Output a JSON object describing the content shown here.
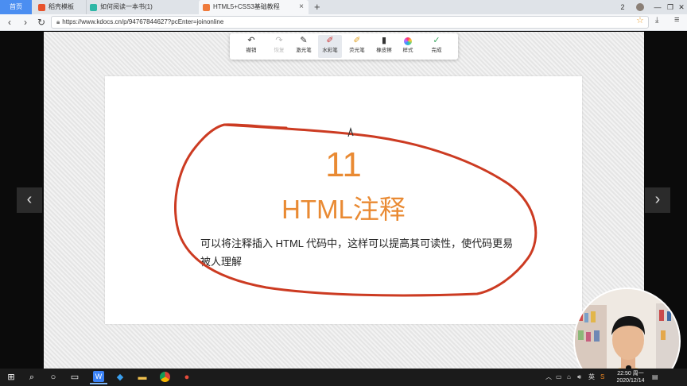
{
  "browser": {
    "tabs": [
      {
        "label": "首页"
      },
      {
        "label": "稻壳模板"
      },
      {
        "label": "如何阅读一本书(1)"
      },
      {
        "label": "HTML5+CSS3基础教程"
      }
    ],
    "new_tab_label": "+",
    "url": "https://www.kdocs.cn/p/94767844627?pcEnter=joinonline",
    "window_controls": [
      "2",
      "—",
      "❐",
      "✕"
    ]
  },
  "toolbar": {
    "tools": [
      {
        "label": "撤销",
        "icon": "undo-icon",
        "glyph": "↶"
      },
      {
        "label": "恢复",
        "icon": "redo-icon",
        "glyph": "↷"
      },
      {
        "label": "激光笔",
        "icon": "laser-pen-icon",
        "glyph": "✎"
      },
      {
        "label": "水彩笔",
        "icon": "watercolor-pen-icon",
        "glyph": "✐"
      },
      {
        "label": "荧光笔",
        "icon": "highlighter-icon",
        "glyph": "✐"
      },
      {
        "label": "橡皮擦",
        "icon": "eraser-icon",
        "glyph": "▮"
      },
      {
        "label": "样式",
        "icon": "style-icon",
        "glyph": ""
      },
      {
        "label": "完成",
        "icon": "done-icon",
        "glyph": "✓"
      }
    ],
    "active_tool": "水彩笔"
  },
  "slide": {
    "number": "11",
    "title": "HTML注释",
    "body": "可以将注释插入 HTML 代码中，这样可以提高其可读性，使代码更易被人理解"
  },
  "colors": {
    "accent_orange": "#e98a33",
    "ink_red": "#cc3b22"
  },
  "taskbar": {
    "tray_lang": "英",
    "clock_time": "22:50 周一",
    "clock_date": "2020/12/14"
  }
}
